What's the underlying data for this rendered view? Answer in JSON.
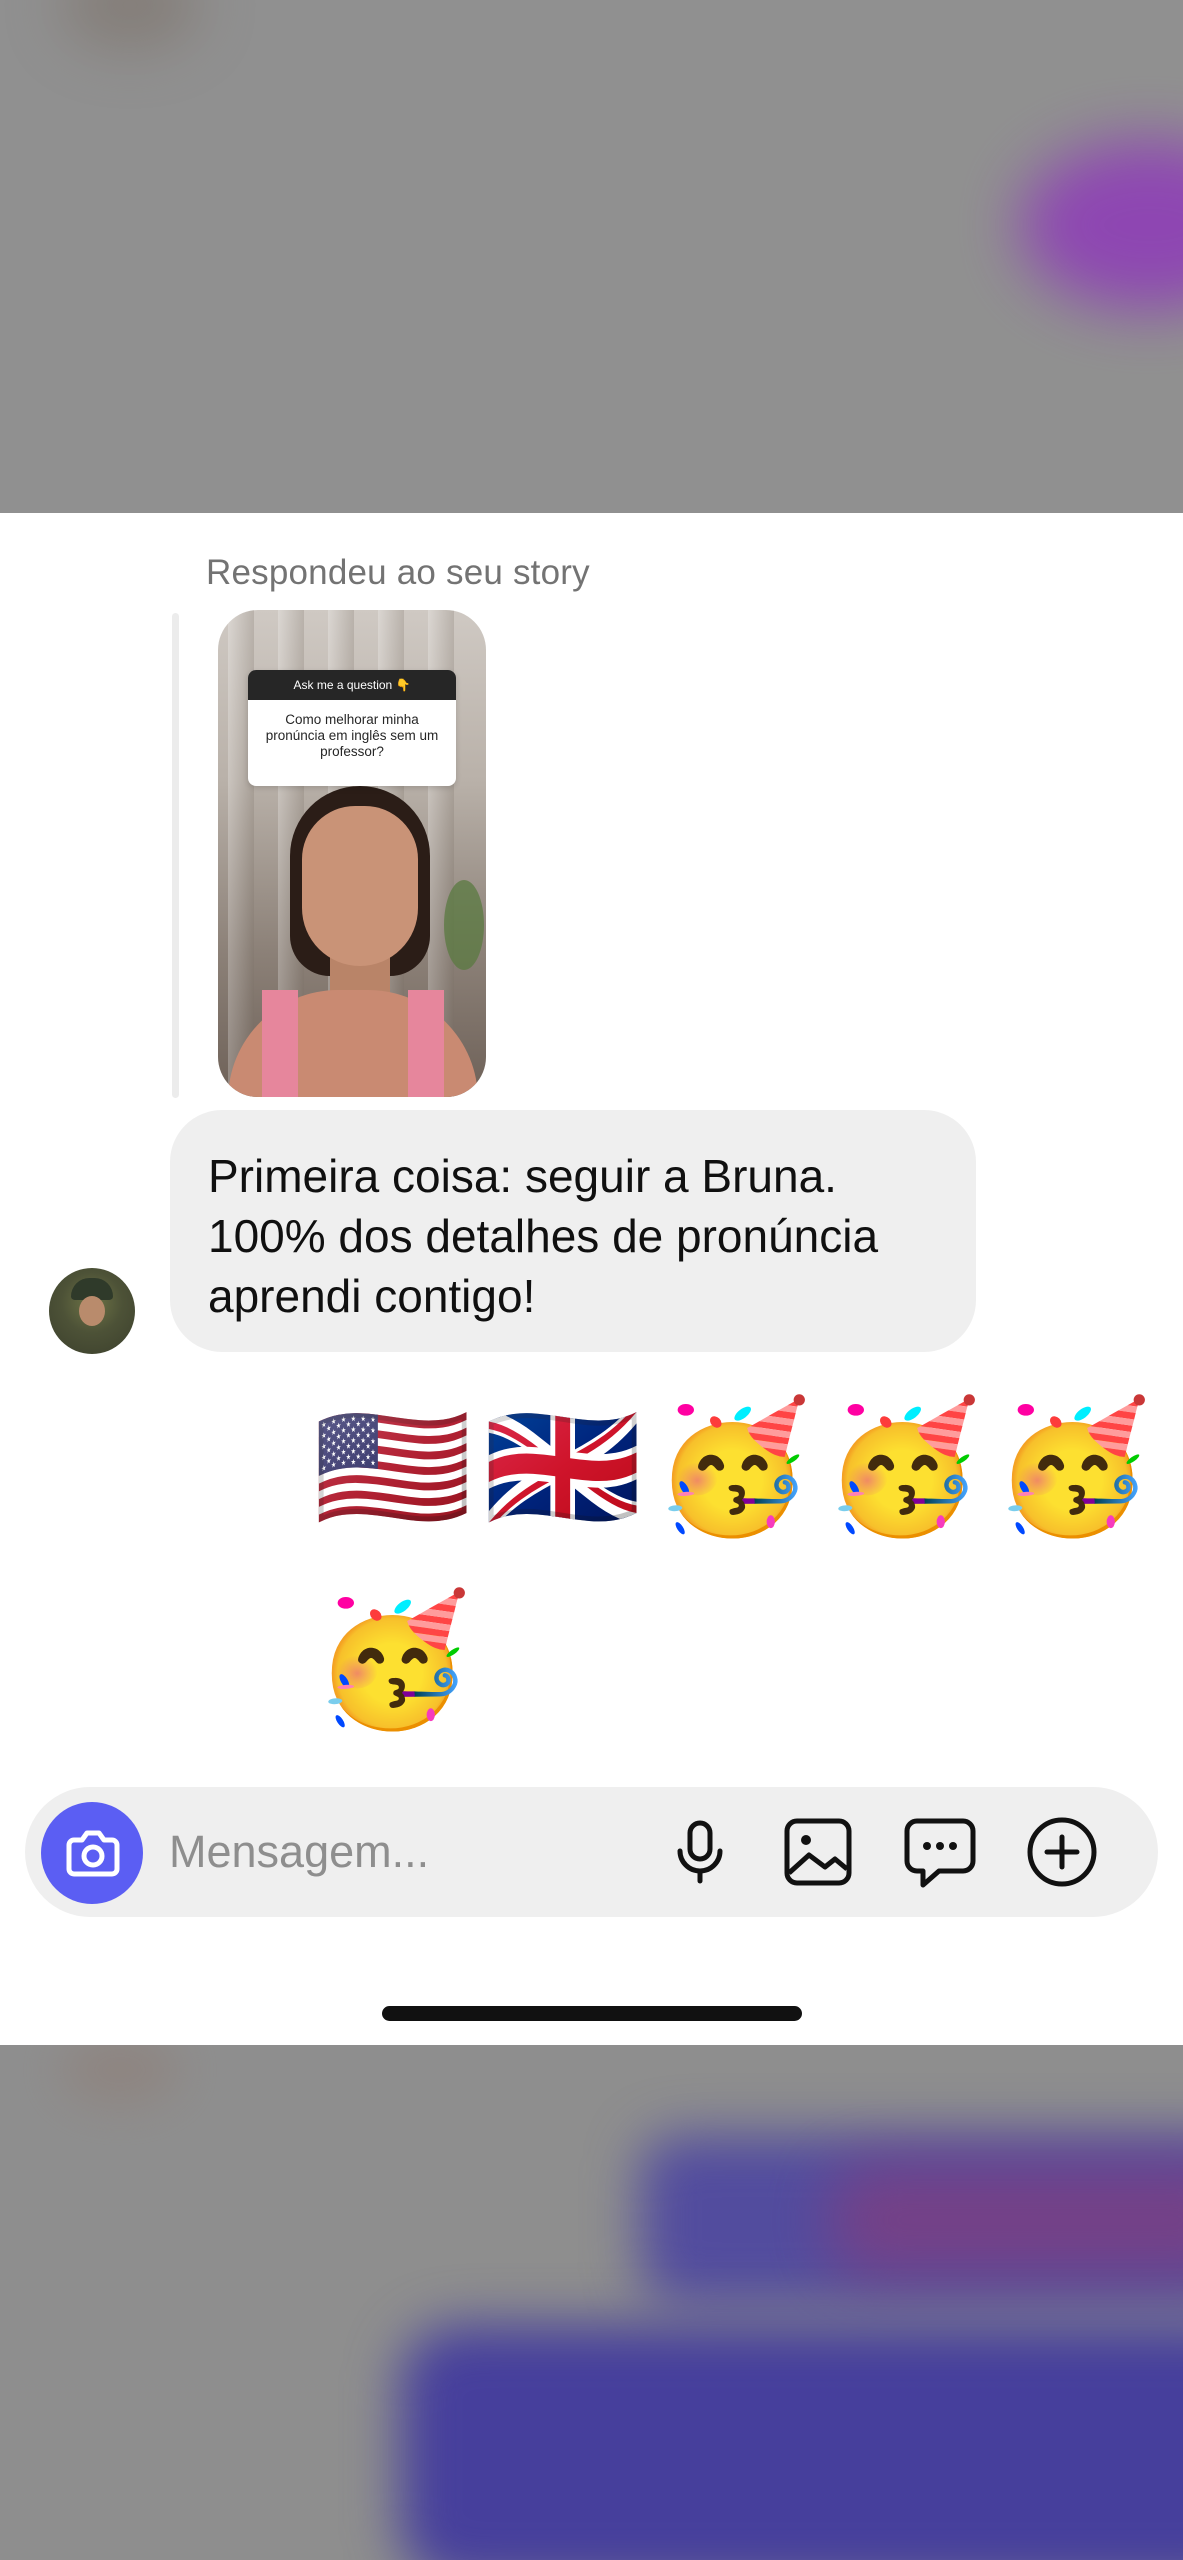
{
  "story_reply": {
    "caption": "Respondeu ao seu story",
    "question_header": "Ask me a question 👇",
    "question_text": "Como melhorar minha pronúncia em inglês sem um professor?"
  },
  "message": {
    "text_line1": "Primeira coisa: seguir a Bruna.",
    "text_line2": "100% dos detalhes de pronúncia",
    "text_line3": "aprendi contigo!"
  },
  "reactions": {
    "row1": [
      "🇺🇸",
      "🇬🇧",
      "🥳",
      "🥳",
      "🥳"
    ],
    "row2": [
      "🥳"
    ]
  },
  "composer": {
    "placeholder": "Mensagem...",
    "icons": [
      "camera-icon",
      "microphone-icon",
      "gallery-icon",
      "chat-bubble-icon",
      "plus-icon"
    ]
  },
  "colors": {
    "camera_button": "#5b5ef3",
    "bubble": "#efefef",
    "caption": "#737373"
  }
}
